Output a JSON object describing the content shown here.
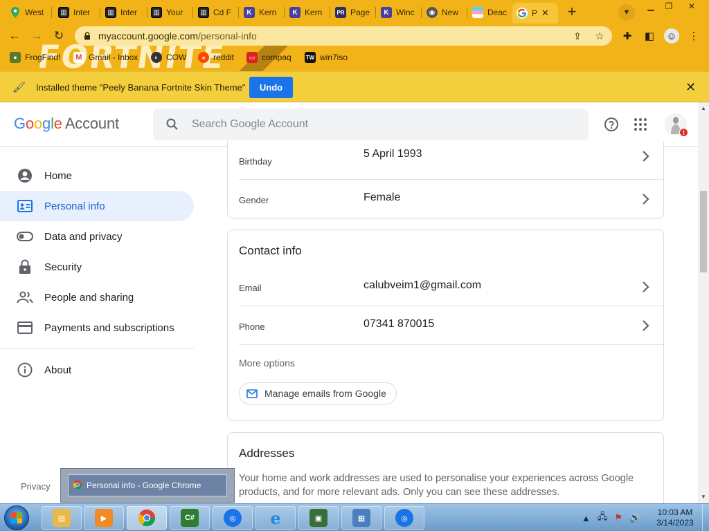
{
  "browser": {
    "tabs": [
      {
        "label": "West",
        "icon": "maps-pin-icon",
        "color": "#34a853"
      },
      {
        "label": "Inter",
        "icon": "archive-icon",
        "color": "#222222"
      },
      {
        "label": "Inter",
        "icon": "archive-icon",
        "color": "#222222"
      },
      {
        "label": "Your",
        "icon": "archive-icon",
        "color": "#222222"
      },
      {
        "label": "Cd F",
        "icon": "archive-icon",
        "color": "#222222"
      },
      {
        "label": "Kern",
        "icon": "k-logo-icon",
        "color": "#4a3f9e"
      },
      {
        "label": "Kern",
        "icon": "k-logo-icon",
        "color": "#4a3f9e"
      },
      {
        "label": "Page",
        "icon": "pr-logo-icon",
        "color": "#2d2d6b"
      },
      {
        "label": "Winc",
        "icon": "k-logo-icon",
        "color": "#4a3f9e"
      },
      {
        "label": "New",
        "icon": "chrome-web-store-icon",
        "color": "#555555"
      },
      {
        "label": "Deac",
        "icon": "flag-icon",
        "color": "#9fd3f5"
      },
      {
        "label": "P",
        "icon": "google-g-icon",
        "color": "#ffffff",
        "active": true
      }
    ],
    "url_host": "myaccount.google.com",
    "url_path": "/personal-info",
    "bookmarks": [
      {
        "label": "FrogFind!",
        "icon": "frogfind-icon",
        "color": "#5a7a2a"
      },
      {
        "label": "Gmail - Inbox",
        "icon": "gmail-icon",
        "color": "#ea4335"
      },
      {
        "label": "COW",
        "icon": "cow-icon",
        "color": "#333333"
      },
      {
        "label": "reddit",
        "icon": "reddit-icon",
        "color": "#ff4500"
      },
      {
        "label": "compaq",
        "icon": "compaq-icon",
        "color": "#e02020"
      },
      {
        "label": "win7iso",
        "icon": "tw-icon",
        "color": "#111111"
      }
    ],
    "infobar": {
      "message": "Installed theme \"Peely Banana Fortnite Skin Theme\"",
      "undo_label": "Undo"
    },
    "theme_art_text": "FORTNITE",
    "theme_color": "#f2b318"
  },
  "header": {
    "logo_google": "Google",
    "logo_account": "Account",
    "search_placeholder": "Search Google Account"
  },
  "sidebar": {
    "items": [
      {
        "label": "Home",
        "icon": "account-circle-icon"
      },
      {
        "label": "Personal info",
        "icon": "id-card-icon",
        "active": true
      },
      {
        "label": "Data and privacy",
        "icon": "toggle-icon"
      },
      {
        "label": "Security",
        "icon": "lock-icon"
      },
      {
        "label": "People and sharing",
        "icon": "people-icon"
      },
      {
        "label": "Payments and subscriptions",
        "icon": "credit-card-icon"
      }
    ],
    "about_label": "About",
    "privacy_label": "Privacy"
  },
  "basic_info": {
    "rows": [
      {
        "label": "Birthday",
        "value": "5 April 1993"
      },
      {
        "label": "Gender",
        "value": "Female"
      }
    ]
  },
  "contact_info": {
    "title": "Contact info",
    "rows": [
      {
        "label": "Email",
        "value": "calubveim1@gmail.com"
      },
      {
        "label": "Phone",
        "value": "07341 870015"
      }
    ],
    "more_options": "More options",
    "manage_emails": "Manage emails from Google"
  },
  "addresses": {
    "title": "Addresses",
    "description": "Your home and work addresses are used to personalise your experiences across Google products, and for more relevant ads. Only you can see these addresses."
  },
  "taskbar": {
    "tooltip": "Personal info - Google Chrome",
    "clock_time": "10:03 AM",
    "clock_date": "3/14/2023",
    "apps": [
      {
        "icon": "file-explorer-icon",
        "color": "#e8b84a"
      },
      {
        "icon": "media-player-icon",
        "color": "#f08a24"
      },
      {
        "icon": "chrome-icon",
        "color": "#db4437",
        "active": true
      },
      {
        "icon": "csharp-icon",
        "color": "#2e7d32"
      },
      {
        "icon": "chrome-user-icon",
        "color": "#1a73e8"
      },
      {
        "icon": "internet-explorer-icon",
        "color": "#1e88e5"
      },
      {
        "icon": "computer-icon",
        "color": "#3a6f3a"
      },
      {
        "icon": "control-panel-icon",
        "color": "#4a7fbf"
      },
      {
        "icon": "chrome-user-icon",
        "color": "#1a73e8"
      }
    ]
  }
}
